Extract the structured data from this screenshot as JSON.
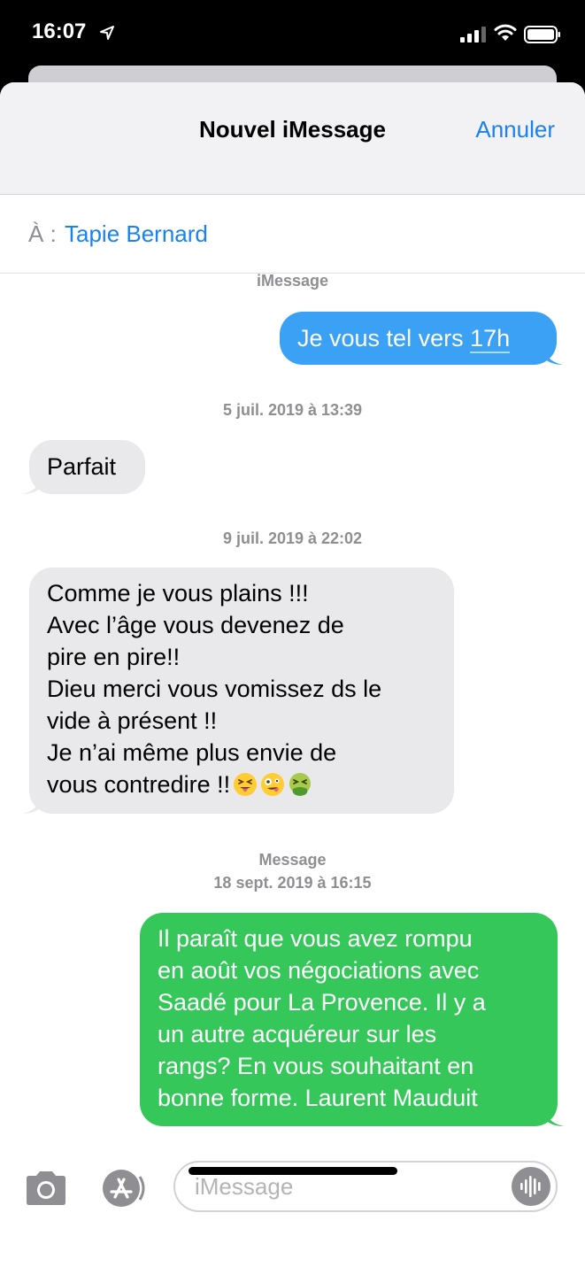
{
  "status_bar": {
    "time": "16:07"
  },
  "nav": {
    "title": "Nouvel iMessage",
    "cancel_label": "Annuler"
  },
  "recipient": {
    "label": "À :",
    "name": "Tapie Bernard"
  },
  "conversation": {
    "service_label_1": "iMessage",
    "sent_1": {
      "text_before": "Je vous tel vers ",
      "text_link": "17h"
    },
    "timestamp_1": "5 juil. 2019 à 13:39",
    "received_1": "Parfait",
    "timestamp_2": "9 juil. 2019 à 22:02",
    "received_2_lines": [
      "Comme je vous plains !!!",
      "Avec l’âge vous devenez de",
      "pire en pire!!",
      "Dieu merci vous vomissez ds le",
      "vide à présent !!",
      "Je n’ai même plus envie de",
      "vous contredire !!"
    ],
    "received_2_emojis": [
      "squinting-tongue-emoji",
      "zany-face-emoji",
      "vomiting-face-emoji"
    ],
    "service_label_2": "Message",
    "timestamp_3": "18 sept. 2019 à 16:15",
    "sent_2_lines": [
      "Il paraît que vous avez rompu",
      "en août vos négociations avec",
      "Saadé pour La Provence. Il y a",
      "un autre acquéreur sur les",
      "rangs? En vous souhaitant en",
      "bonne forme. Laurent Mauduit"
    ]
  },
  "composer": {
    "placeholder": "iMessage"
  },
  "colors": {
    "imessage_blue": "#3aa1f5",
    "sms_green": "#35c759",
    "received_gray": "#e9e9eb",
    "link_blue": "#1a82f0"
  }
}
